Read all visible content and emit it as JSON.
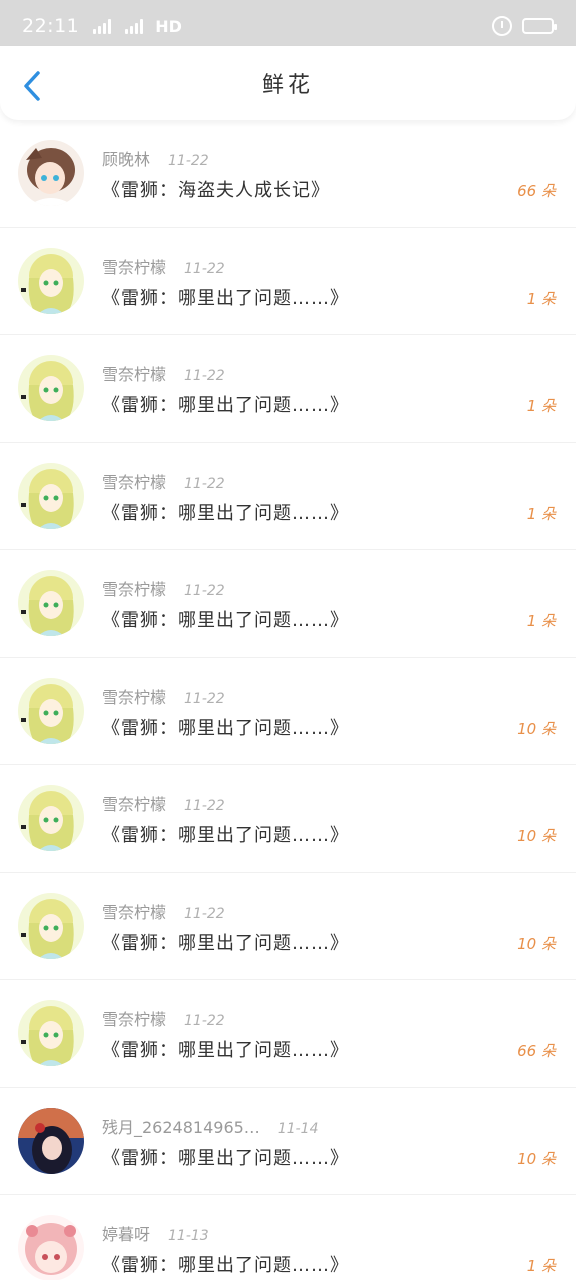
{
  "status_bar": {
    "time": "22:11",
    "network_1": "4G",
    "network_2": "4G",
    "hd": "HD",
    "icons": [
      "signal-icon",
      "signal-icon",
      "alarm-icon",
      "battery-icon"
    ]
  },
  "header": {
    "title": "鲜花",
    "back_icon": "back-chevron-icon",
    "accent_color": "#2f8fe0"
  },
  "items": [
    {
      "name": "顾晚林",
      "date": "11-22",
      "title": "《雷狮：海盗夫人成长记》",
      "count": "66 朵",
      "avatar": "avatar-brown-hair"
    },
    {
      "name": "雪奈柠檬",
      "date": "11-22",
      "title": "《雷狮：哪里出了问题……》",
      "count": "1 朵",
      "avatar": "avatar-green-blonde"
    },
    {
      "name": "雪奈柠檬",
      "date": "11-22",
      "title": "《雷狮：哪里出了问题……》",
      "count": "1 朵",
      "avatar": "avatar-green-blonde"
    },
    {
      "name": "雪奈柠檬",
      "date": "11-22",
      "title": "《雷狮：哪里出了问题……》",
      "count": "1 朵",
      "avatar": "avatar-green-blonde"
    },
    {
      "name": "雪奈柠檬",
      "date": "11-22",
      "title": "《雷狮：哪里出了问题……》",
      "count": "1 朵",
      "avatar": "avatar-green-blonde"
    },
    {
      "name": "雪奈柠檬",
      "date": "11-22",
      "title": "《雷狮：哪里出了问题……》",
      "count": "10 朵",
      "avatar": "avatar-green-blonde"
    },
    {
      "name": "雪奈柠檬",
      "date": "11-22",
      "title": "《雷狮：哪里出了问题……》",
      "count": "10 朵",
      "avatar": "avatar-green-blonde"
    },
    {
      "name": "雪奈柠檬",
      "date": "11-22",
      "title": "《雷狮：哪里出了问题……》",
      "count": "10 朵",
      "avatar": "avatar-green-blonde"
    },
    {
      "name": "雪奈柠檬",
      "date": "11-22",
      "title": "《雷狮：哪里出了问题……》",
      "count": "66 朵",
      "avatar": "avatar-green-blonde"
    },
    {
      "name": "残月_2624814965…",
      "date": "11-14",
      "title": "《雷狮：哪里出了问题……》",
      "count": "10 朵",
      "avatar": "avatar-dark-night"
    },
    {
      "name": "婷暮呀",
      "date": "11-13",
      "title": "《雷狮：哪里出了问题……》",
      "count": "1 朵",
      "avatar": "avatar-pink-hair"
    }
  ],
  "colors": {
    "count_color": "#e8904a",
    "status_bar_bg": "#d9d9d9"
  }
}
